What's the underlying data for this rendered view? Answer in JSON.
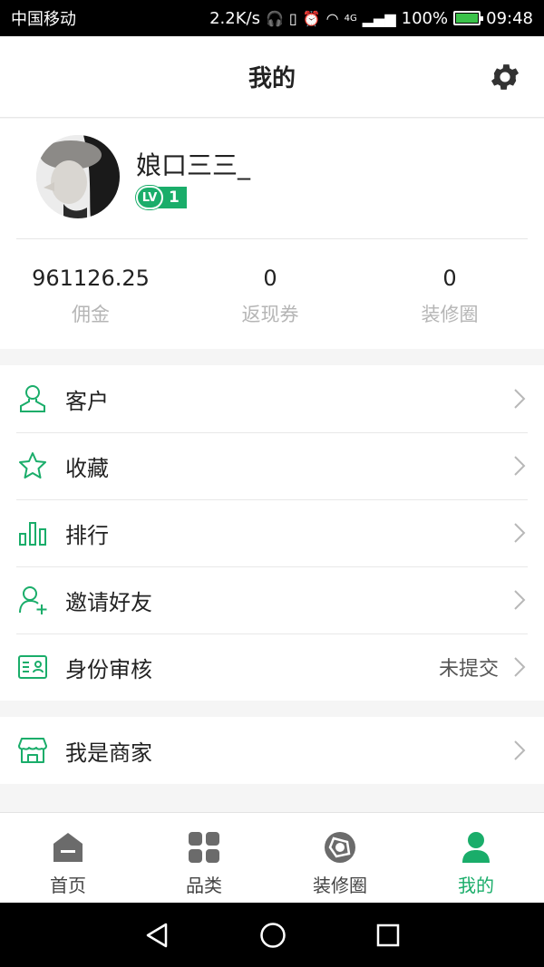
{
  "status_bar": {
    "carrier": "中国移动",
    "network_speed": "2.2K/s",
    "signal_label": "4G",
    "battery": "100%",
    "time": "09:48"
  },
  "header": {
    "title": "我的",
    "settings_icon": "gear-icon"
  },
  "profile": {
    "username": "娘口三三_",
    "level_badge": "LV",
    "level": "1",
    "stats": [
      {
        "value": "961126.25",
        "label": "佣金"
      },
      {
        "value": "0",
        "label": "返现券"
      },
      {
        "value": "0",
        "label": "装修圈"
      }
    ]
  },
  "menu": {
    "items": [
      {
        "label": "客户",
        "icon": "user-icon",
        "value": ""
      },
      {
        "label": "收藏",
        "icon": "star-icon",
        "value": ""
      },
      {
        "label": "排行",
        "icon": "bar-chart-icon",
        "value": ""
      },
      {
        "label": "邀请好友",
        "icon": "add-user-icon",
        "value": ""
      },
      {
        "label": "身份审核",
        "icon": "id-card-icon",
        "value": "未提交"
      }
    ],
    "merchant": {
      "label": "我是商家",
      "icon": "store-icon"
    }
  },
  "tabbar": {
    "tabs": [
      {
        "label": "首页",
        "icon": "home-icon"
      },
      {
        "label": "品类",
        "icon": "grid-icon"
      },
      {
        "label": "装修圈",
        "icon": "aperture-icon"
      },
      {
        "label": "我的",
        "icon": "person-icon",
        "active": true
      }
    ]
  },
  "colors": {
    "accent": "#1aad6a",
    "inactive_icon": "#6b6b6b",
    "muted_text": "#b5b5b5"
  }
}
